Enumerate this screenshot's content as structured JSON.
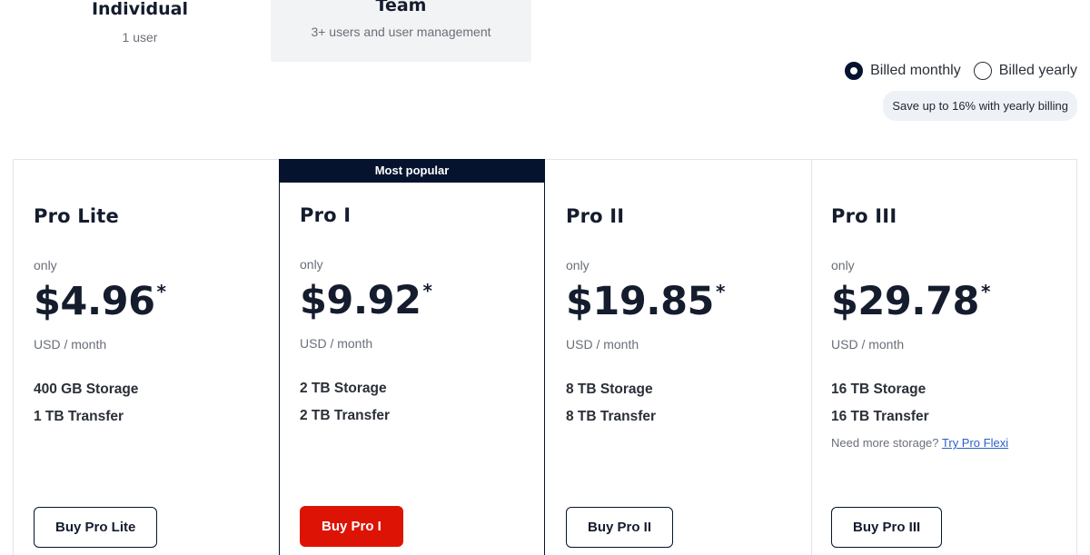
{
  "tabs": [
    {
      "title": "Individual",
      "subtitle": "1 user"
    },
    {
      "title": "Team",
      "subtitle": "3+ users and user management"
    }
  ],
  "billing": {
    "monthly_label": "Billed monthly",
    "yearly_label": "Billed yearly",
    "selected": "monthly",
    "save_note": "Save up to 16% with yearly billing"
  },
  "plans": [
    {
      "name": "Pro Lite",
      "only_label": "only",
      "price": "$4.96",
      "asterisk": "*",
      "unit": "USD / month",
      "storage": "400 GB Storage",
      "transfer": "1 TB Transfer",
      "button": "Buy Pro Lite"
    },
    {
      "name": "Pro I",
      "badge": "Most popular",
      "only_label": "only",
      "price": "$9.92",
      "asterisk": "*",
      "unit": "USD / month",
      "storage": "2 TB Storage",
      "transfer": "2 TB Transfer",
      "button": "Buy Pro I"
    },
    {
      "name": "Pro II",
      "only_label": "only",
      "price": "$19.85",
      "asterisk": "*",
      "unit": "USD / month",
      "storage": "8 TB Storage",
      "transfer": "8 TB Transfer",
      "button": "Buy Pro II"
    },
    {
      "name": "Pro III",
      "only_label": "only",
      "price": "$29.78",
      "asterisk": "*",
      "unit": "USD / month",
      "storage": "16 TB Storage",
      "transfer": "16 TB Transfer",
      "more_text": "Need more storage?",
      "more_link": "Try Pro Flexi",
      "button": "Buy Pro III"
    }
  ],
  "colors": {
    "navy": "#05132e",
    "primary_button": "#dd1405",
    "link": "#2b5fc7"
  }
}
